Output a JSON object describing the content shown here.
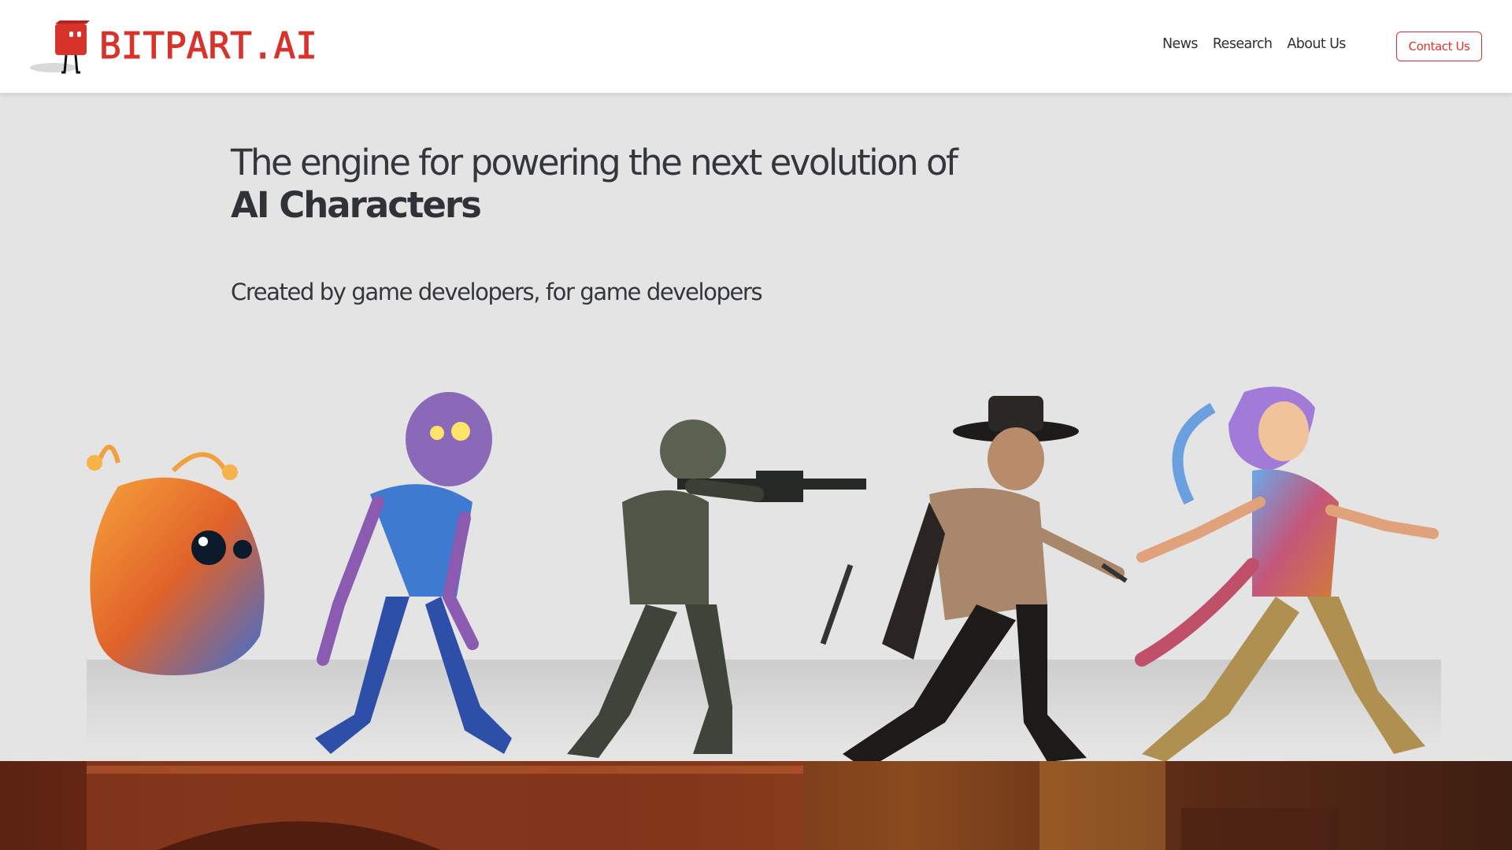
{
  "brand": {
    "name": "BITPART.AI",
    "logo_icon": "red-cube-mascot-icon",
    "color": "#d8332a"
  },
  "nav": {
    "items": [
      "News",
      "Research",
      "About Us"
    ]
  },
  "contact_button": {
    "label": "Contact Us"
  },
  "hero": {
    "headline": "The engine for powering the next evolution of",
    "headline_emphasis": "AI Characters",
    "tagline": "Created by game developers, for game developers",
    "characters": [
      "fuzzy-creature",
      "zombie",
      "soldier",
      "cowboy",
      "elf-woman"
    ]
  },
  "colors": {
    "hero_background": "#e4e4e4",
    "text": "#2f3236",
    "accent": "#d8332a"
  }
}
